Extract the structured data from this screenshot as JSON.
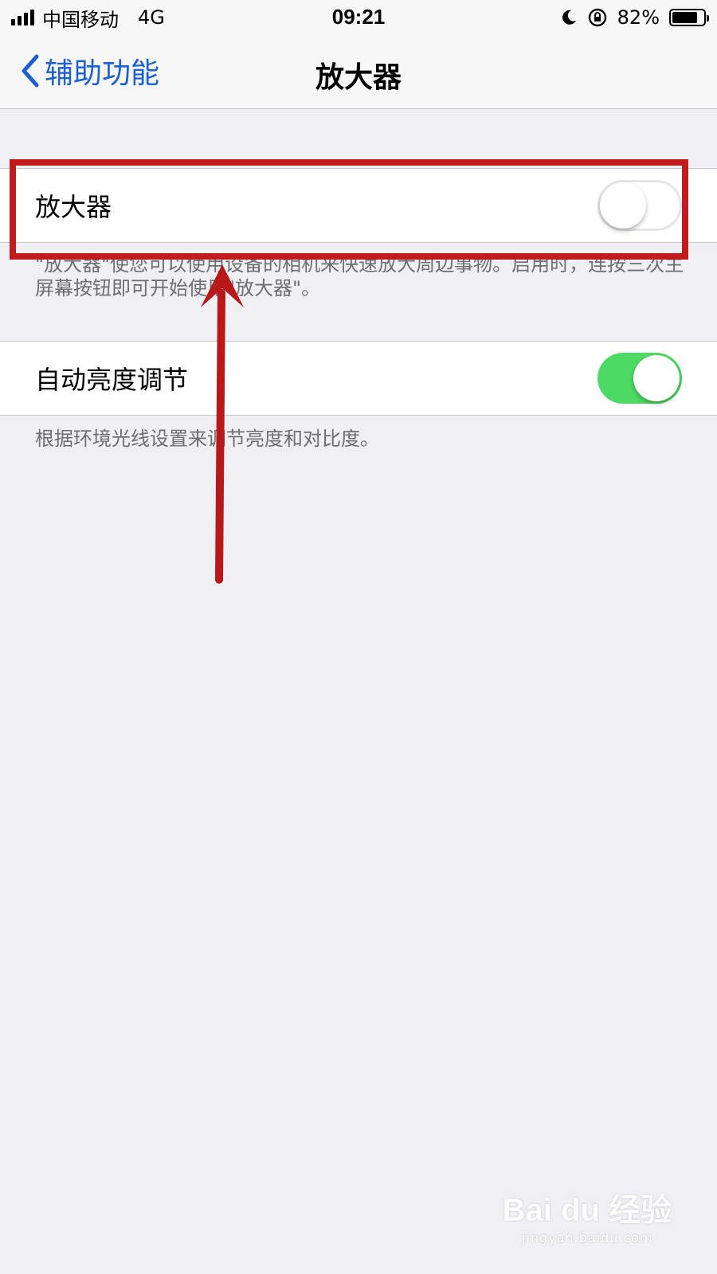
{
  "status_bar": {
    "carrier": "中国移动",
    "network": "4G",
    "time": "09:21",
    "battery_percent_text": "82%",
    "battery_level": 0.82,
    "icons": [
      "signal-bars-icon",
      "moon-icon",
      "rotation-lock-icon",
      "battery-icon"
    ]
  },
  "nav": {
    "back_label": "辅助功能",
    "title": "放大器"
  },
  "settings": [
    {
      "label": "放大器",
      "toggle_on": false,
      "footer": "\"放大器\"使您可以使用设备的相机来快速放大周边事物。启用时，连按三次主屏幕按钮即可开始使用\"放大器\"。"
    },
    {
      "label": "自动亮度调节",
      "toggle_on": true,
      "footer": "根据环境光线设置来调节亮度和对比度。"
    }
  ],
  "colors": {
    "accent_blue": "#1b5fd1",
    "toggle_on_green": "#4cd964",
    "annotation_red": "#c21b1b",
    "background": "#efeff4"
  },
  "watermark": {
    "logo": "Bai du 经验",
    "url": "jingyan.baidu.com"
  }
}
